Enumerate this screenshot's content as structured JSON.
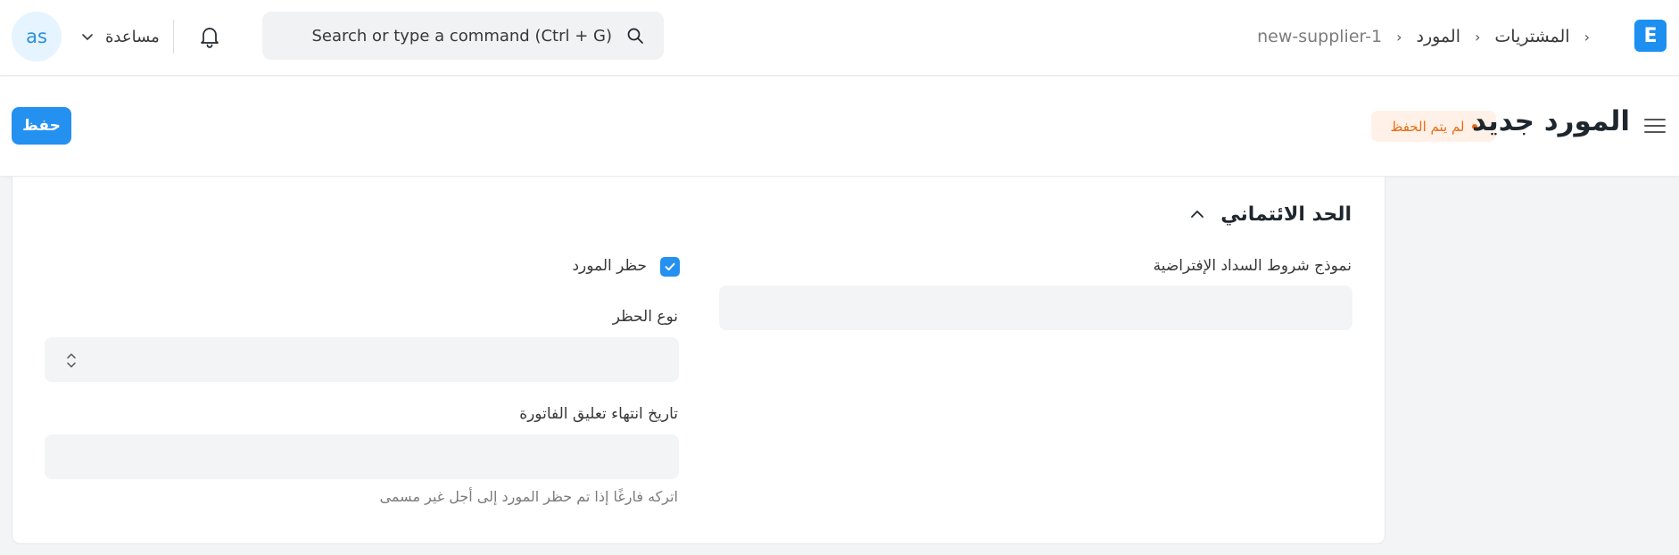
{
  "navbar": {
    "avatar_initials": "as",
    "help_label": "مساعدة",
    "search_placeholder": "Search or type a command (Ctrl + G)",
    "breadcrumbs": [
      "المشتريات",
      "المورد",
      "new-supplier-1"
    ],
    "logo_letter": "E"
  },
  "page_head": {
    "title": "المورد جديد",
    "status": "لم يتم الحفظ",
    "save_label": "حفظ"
  },
  "section": {
    "title": "الحد الائتماني",
    "payment_terms_label": "نموذج شروط السداد الإفتراضية",
    "payment_terms_value": "",
    "hold_label": "حظر المورد",
    "hold_checked": true,
    "hold_type_label": "نوع الحظر",
    "hold_type_value": "",
    "release_date_label": "تاريخ انتهاء تعليق الفاتورة",
    "release_date_value": "",
    "release_date_help": "اتركه فارغًا إذا تم حظر المورد إلى أجل غير مسمى"
  },
  "colors": {
    "primary": "#2490ef",
    "status_text": "#e86c13",
    "status_bg": "#fff1e7"
  }
}
